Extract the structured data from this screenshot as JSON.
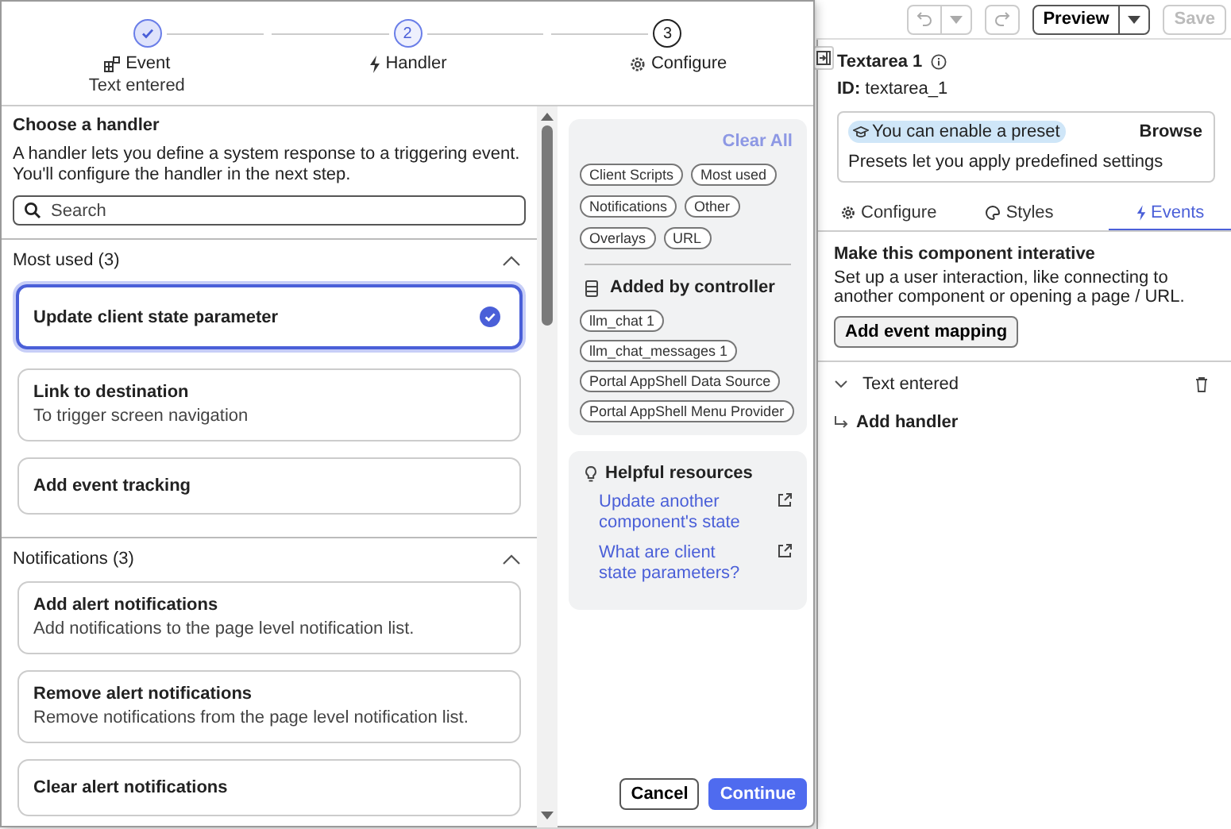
{
  "stepper": {
    "steps": [
      {
        "completed": true,
        "active": false,
        "label": "Event",
        "sublabel": "Text entered"
      },
      {
        "completed": false,
        "active": true,
        "number": "2",
        "label": "Handler"
      },
      {
        "completed": false,
        "active": false,
        "number": "3",
        "label": "Configure"
      }
    ]
  },
  "handlers": {
    "title": "Choose a handler",
    "description": "A handler lets you define a system response to a triggering event. You'll configure the handler in the next step.",
    "search": {
      "placeholder": "Search"
    },
    "groups": [
      {
        "title": "Most used (3)",
        "expanded": true,
        "items": [
          {
            "title": "Update client state parameter",
            "selected": true
          },
          {
            "title": "Link to destination",
            "description": "To trigger screen navigation",
            "selected": false
          },
          {
            "title": "Add event tracking",
            "selected": false
          }
        ]
      },
      {
        "title": "Notifications (3)",
        "expanded": true,
        "items": [
          {
            "title": "Add alert notifications",
            "description": "Add notifications to the page level notification list.",
            "selected": false
          },
          {
            "title": "Remove alert notifications",
            "description": "Remove notifications from the page level notification list.",
            "selected": false
          },
          {
            "title": "Clear alert notifications",
            "selected": false
          }
        ]
      }
    ]
  },
  "filters": {
    "clear_all": {
      "label": "Clear All",
      "disabled": true
    },
    "chips": [
      "Client Scripts",
      "Most used",
      "Notifications",
      "Other",
      "Overlays",
      "URL"
    ],
    "controller_title": "Added by controller",
    "controller_chips": [
      "llm_chat 1",
      "llm_chat_messages 1",
      "Portal AppShell Data Source",
      "Portal AppShell Menu Provider"
    ]
  },
  "resources": {
    "title": "Helpful resources",
    "links": [
      "Update another component's state",
      "What are client state parameters?"
    ]
  },
  "footer": {
    "cancel": "Cancel",
    "continue": "Continue"
  },
  "toolbar": {
    "undo_disabled": true,
    "redo_disabled": true,
    "preview": "Preview",
    "save": {
      "label": "Save",
      "disabled": true
    }
  },
  "inspector": {
    "title": "Textarea 1",
    "id_label": "ID:",
    "id_value": "textarea_1",
    "preset": {
      "badge": "You can enable a preset",
      "action": "Browse",
      "description": "Presets let you apply predefined settings"
    },
    "tabs": [
      {
        "label": "Configure",
        "selected": false
      },
      {
        "label": "Styles",
        "selected": false
      },
      {
        "label": "Events",
        "selected": true
      }
    ],
    "events": {
      "heading": "Make this component interative",
      "description": "Set up a user interaction, like connecting to another component or opening a page / URL.",
      "button": "Add event mapping",
      "rows": [
        {
          "label": "Text entered",
          "expanded": true
        }
      ],
      "add_handler": "Add handler"
    }
  }
}
